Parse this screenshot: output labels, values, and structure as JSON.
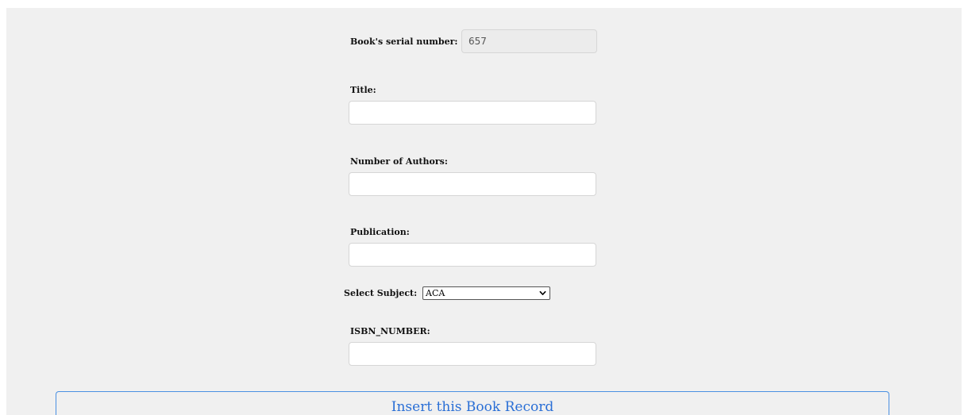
{
  "form": {
    "serial": {
      "label": "Book's serial number:",
      "value": "657"
    },
    "title": {
      "label": "Title:",
      "value": "",
      "placeholder": ""
    },
    "authors": {
      "label": "Number of Authors:",
      "value": "",
      "placeholder": ""
    },
    "publication": {
      "label": "Publication:",
      "value": "",
      "placeholder": ""
    },
    "subject": {
      "label": "Select Subject:",
      "selected": "ACA"
    },
    "isbn": {
      "label": "ISBN_NUMBER:",
      "value": "",
      "placeholder": ""
    },
    "submit_label": "Insert this Book Record"
  },
  "icons": {
    "subject_dropdown": "chevron-down-icon"
  },
  "colors": {
    "panel_background": "#f0f0f0",
    "button_accent": "#4a90e2",
    "button_text": "#2a6fd6"
  }
}
